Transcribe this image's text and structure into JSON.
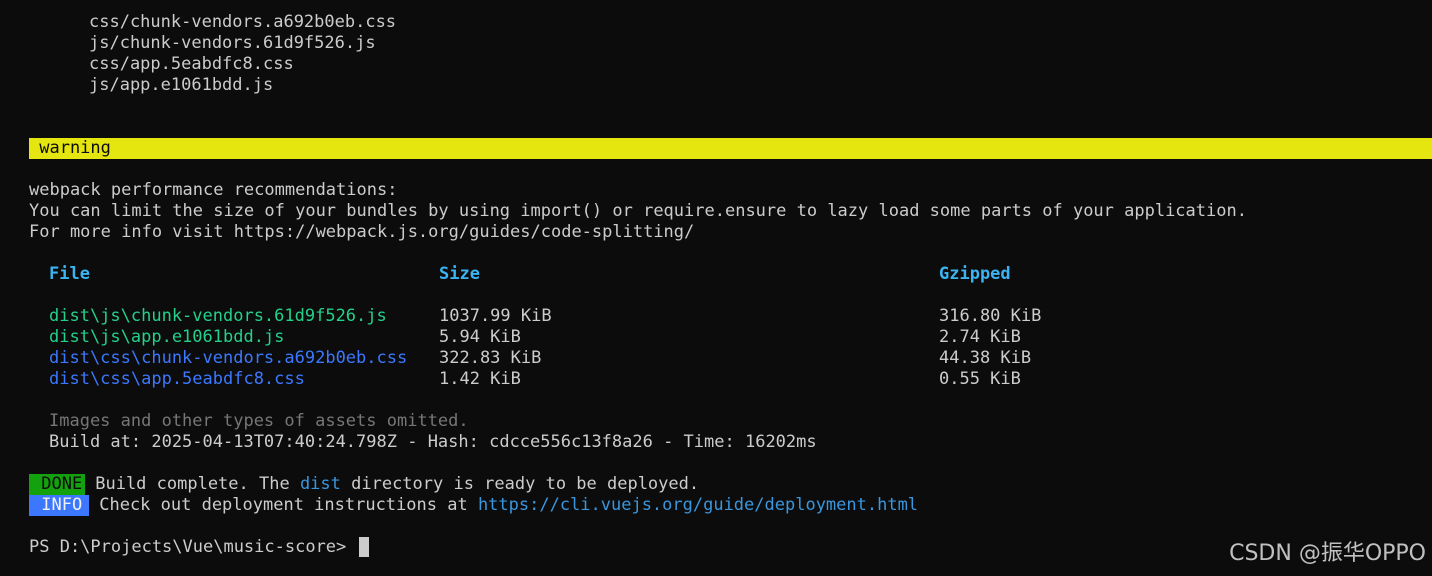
{
  "asset_lines": [
    "css/chunk-vendors.a692b0eb.css",
    "js/chunk-vendors.61d9f526.js",
    "css/app.5eabdfc8.css",
    "js/app.e1061bdd.js"
  ],
  "warning_label": " warning",
  "recommendations": {
    "title": "webpack performance recommendations:",
    "line1": "You can limit the size of your bundles by using import() or require.ensure to lazy load some parts of your application.",
    "line2": "For more info visit https://webpack.js.org/guides/code-splitting/"
  },
  "table": {
    "headers": [
      "File",
      "Size",
      "Gzipped"
    ],
    "rows": [
      {
        "file": "dist\\js\\chunk-vendors.61d9f526.js",
        "size": "1037.99 KiB",
        "gzipped": "316.80 KiB",
        "kind": "js"
      },
      {
        "file": "dist\\js\\app.e1061bdd.js",
        "size": "5.94 KiB",
        "gzipped": "2.74 KiB",
        "kind": "js"
      },
      {
        "file": "dist\\css\\chunk-vendors.a692b0eb.css",
        "size": "322.83 KiB",
        "gzipped": "44.38 KiB",
        "kind": "css"
      },
      {
        "file": "dist\\css\\app.5eabdfc8.css",
        "size": "1.42 KiB",
        "gzipped": "0.55 KiB",
        "kind": "css"
      }
    ]
  },
  "omitted_note": "Images and other types of assets omitted.",
  "build_info": "Build at: 2025-04-13T07:40:24.798Z - Hash: cdcce556c13f8a26 - Time: 16202ms",
  "done": {
    "badge": " DONE ",
    "text_before": " Build complete. The ",
    "dir": "dist",
    "text_after": " directory is ready to be deployed."
  },
  "info": {
    "badge": " INFO ",
    "text": " Check out deployment instructions at ",
    "link": "https://cli.vuejs.org/guide/deployment.html"
  },
  "prompt": "PS D:\\Projects\\Vue\\music-score> ",
  "watermark": "CSDN @振华OPPO",
  "colors": {
    "background": "#0c0c0c",
    "foreground": "#cccccc",
    "warning_bg": "#e5e510",
    "header": "#3ab4f2",
    "js_file": "#23d18b",
    "css_file": "#3b78ff",
    "done_bg": "#13a10e",
    "info_bg": "#3b78ff",
    "link": "#3a96dd"
  }
}
